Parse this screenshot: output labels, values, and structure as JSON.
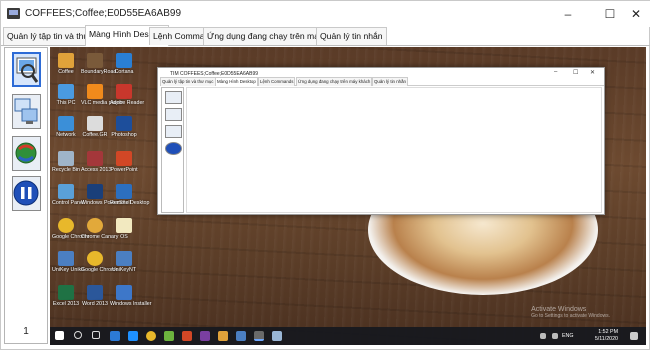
{
  "window": {
    "title": "COFFEES;Coffee;E0D55EA6AB99"
  },
  "tabs": [
    {
      "label": "Quản lý tập tin và thư mục"
    },
    {
      "label": "Màng Hình Desktop"
    },
    {
      "label": "Lệnh Commands"
    },
    {
      "label": "Ứng dụng đang chạy trên máy khách"
    },
    {
      "label": "Quản lý tin nhắn"
    }
  ],
  "leftpanel": {
    "page_number": "1",
    "buttons": [
      {
        "icon": "screen-capture-icon"
      },
      {
        "icon": "monitors-icon"
      },
      {
        "icon": "refresh-globe-icon"
      },
      {
        "icon": "pause-icon"
      }
    ]
  },
  "desktop_icons": [
    {
      "label": "Coffee"
    },
    {
      "label": "BoundaryRoad"
    },
    {
      "label": "Cortana"
    },
    {
      "label": "This PC"
    },
    {
      "label": "VLC media player"
    },
    {
      "label": "Adobe Reader"
    },
    {
      "label": "Network"
    },
    {
      "label": "Coffee.GR"
    },
    {
      "label": "Photoshop"
    },
    {
      "label": "Recycle Bin"
    },
    {
      "label": "Access 2013"
    },
    {
      "label": "PowerPoint"
    },
    {
      "label": "Control Panel"
    },
    {
      "label": "Windows PowerShell"
    },
    {
      "label": "Remote Desktop"
    },
    {
      "label": "Google Chrome"
    },
    {
      "label": "Chrome Canary"
    },
    {
      "label": "OS"
    },
    {
      "label": "UniKey Unikit"
    },
    {
      "label": "Google Chrome"
    },
    {
      "label": "UniKeyNT"
    },
    {
      "label": "Excel 2013"
    },
    {
      "label": "Word 2013"
    },
    {
      "label": "Windows Installer"
    }
  ],
  "remote_window": {
    "title": "TIM COFFEES;Coffee;E0D55EA6AB99",
    "tabs": [
      "Quản lý tập tin và thư mục",
      "Màng Hình Desktop",
      "Lệnh Commands",
      "Ứng dụng đang chạy trên máy khách",
      "Quản lý tin nhắn"
    ]
  },
  "watermark": {
    "line1": "Activate Windows",
    "line2": "Go to Settings to activate Windows."
  },
  "taskbar": {
    "language": "ENG",
    "time": "1:52 PM",
    "date": "5/11/2020"
  },
  "colors": {
    "accent": "#2d6bd6",
    "taskbar": "#16181e"
  }
}
